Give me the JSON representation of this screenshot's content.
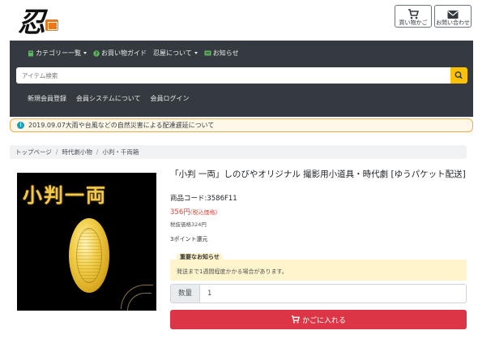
{
  "header": {
    "logo_text": "忍",
    "cart_label": "買い物かご",
    "contact_label": "お問い合わせ"
  },
  "nav": {
    "category": "カテゴリー一覧",
    "guide": "お買い物ガイド",
    "about": "忍屋について",
    "news": "お知らせ"
  },
  "search": {
    "placeholder": "アイテム検索"
  },
  "member_nav": {
    "register": "新規会員登録",
    "system": "会員システムについて",
    "login": "会員ログイン"
  },
  "alert": {
    "text": "2019.09.07大雨や台風などの自然災害による配達遅延について"
  },
  "breadcrumb": [
    "トップページ",
    "時代劇小物",
    "小判・千両箱"
  ],
  "product": {
    "image_caption": "小判一両",
    "title": "「小判 一両」しのびやオリジナル 撮影用小道具・時代劇 [ゆうパケット配送]",
    "code": "商品コード:3586F11",
    "price": "356円",
    "price_tax": "(税込価格)",
    "pretax": "税抜価格324円",
    "points": "3ポイント還元",
    "notice_title": "重要なお知らせ",
    "notice_text": "発送まで1週間程度かかる場合があります。",
    "qty_label": "数量",
    "qty_value": "1",
    "cart_button": "かごに入れる"
  },
  "colors": {
    "navbar": "#343a40",
    "search_button": "#ffc107",
    "price": "#e0463f",
    "cart_button": "#dc3545",
    "notice_bg": "#fff4cc",
    "alert_border": "#f0ad4e"
  },
  "icons": [
    "cart-icon",
    "mail-icon",
    "search-icon",
    "info-icon",
    "book-icon",
    "question-icon",
    "news-icon"
  ]
}
